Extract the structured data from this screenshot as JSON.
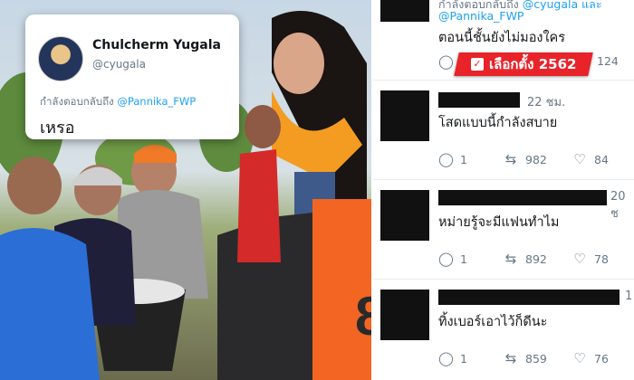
{
  "photo": {
    "tweet_card": {
      "name": "Chulcherm Yugala",
      "handle": "@cyugala",
      "replying_prefix": "กำลังตอบกลับถึง ",
      "replying_handle": "@Pannika_FWP",
      "text": "เหรอ"
    },
    "poster_number": "8"
  },
  "thread": {
    "top": {
      "replying_prefix": "กำลังตอบกลับถึง ",
      "replying_handle": "@cyugala และ",
      "replying_handle2": "@Pannika_FWP",
      "text": "ตอนนี้ชั้นยังไม่มองใคร",
      "reply_count": "",
      "retweet_count": "",
      "like_count": "124"
    },
    "badge": {
      "label": "เลือกตั้ง 2562"
    },
    "replies": [
      {
        "time": "22 ชม.",
        "text": "โสดแบบนี้กำลังสบาย",
        "reply_count": "1",
        "retweet_count": "982",
        "like_count": "84"
      },
      {
        "time": "20 ช",
        "text": "หม่ายรู้จะมีแฟนทำไม",
        "reply_count": "1",
        "retweet_count": "892",
        "like_count": "78"
      },
      {
        "time": "1",
        "text": "ทิ้งเบอร์เอาไว้ก็ดีนะ",
        "reply_count": "1",
        "retweet_count": "859",
        "like_count": "76"
      }
    ]
  },
  "colors": {
    "twitter_blue": "#1da1f2",
    "badge_red": "#e8232a",
    "text_dark": "#14171a",
    "text_gray": "#657786"
  },
  "icons": [
    "reply-icon",
    "retweet-icon",
    "like-icon",
    "checkbox-icon"
  ]
}
